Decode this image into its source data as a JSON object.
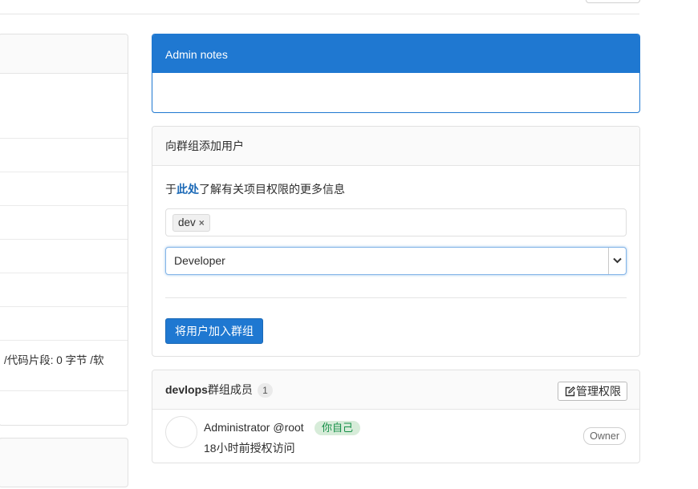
{
  "left_panel": {
    "snippet_text": "/代码片段: 0 字节 /软"
  },
  "admin_notes": {
    "title": "Admin notes"
  },
  "add_users": {
    "title": "向群组添加用户",
    "help_prefix": "于",
    "help_link": "此处",
    "help_suffix": "了解有关项目权限的更多信息",
    "selected_token": "dev",
    "token_remove": "×",
    "role_value": "Developer",
    "submit_label": "将用户加入群组"
  },
  "members": {
    "title_bold": "devlops",
    "title_rest": "群组成员",
    "count": "1",
    "manage_label": "管理权限",
    "rows": [
      {
        "name": "Administrator",
        "username": "@root",
        "you_badge": "你自己",
        "granted": "18小时前授权访问",
        "role": "Owner"
      }
    ]
  },
  "colors": {
    "primary": "#1f78d1",
    "success_bg": "#d7ecd9",
    "success_text": "#168f48"
  },
  "icons": {
    "token_remove": "close-icon",
    "select_caret": "chevron-down-icon",
    "manage": "edit-icon"
  }
}
